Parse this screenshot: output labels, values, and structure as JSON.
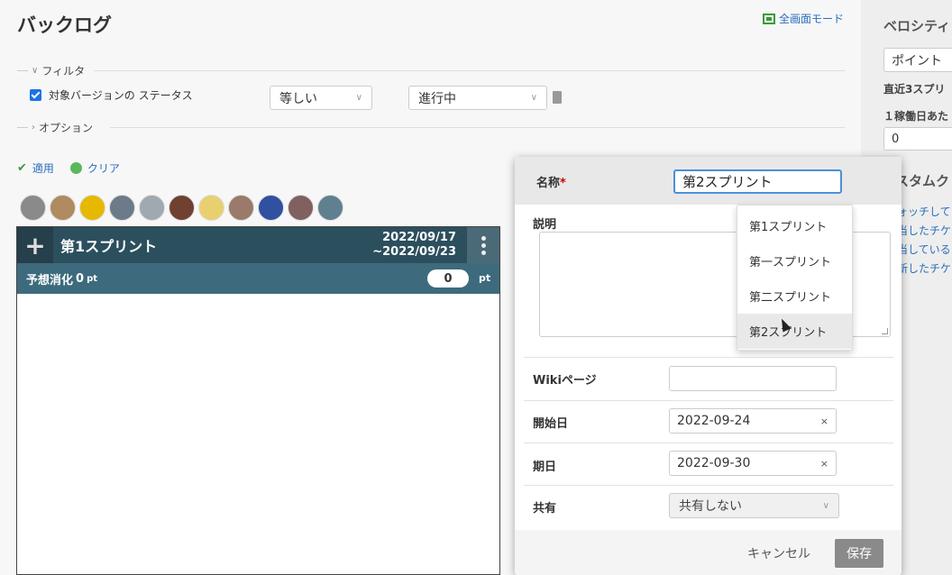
{
  "header": {
    "title": "バックログ",
    "fullscreen_label": "全画面モード"
  },
  "filter": {
    "legend": "フィルタ",
    "checkbox_label": "対象バージョンの ステータス",
    "checked": true,
    "operator": "等しい",
    "value": "進行中"
  },
  "options": {
    "legend": "オプション"
  },
  "actions": {
    "apply": "適用",
    "clear": "クリア"
  },
  "avatar_colors": [
    "#8a8a8a",
    "#b08a60",
    "#e6b800",
    "#6c7a89",
    "#a0a8b0",
    "#704030",
    "#e8d070",
    "#9a7a6a",
    "#3050a0",
    "#806060",
    "#608090"
  ],
  "sprint": {
    "title": "第1スプリント",
    "date_start": "2022/09/17",
    "date_end": "~2022/09/23",
    "forecast_label": "予想消化",
    "forecast_value": "0",
    "forecast_unit": "pt",
    "points_value": "0",
    "points_unit": "pt"
  },
  "sidebar": {
    "title": "ベロシティ",
    "select_value": "ポイント",
    "recent_label": "直近3スプリ",
    "per_day_label": "１稼働日あた",
    "per_day_value": "0",
    "custom_heading": "スタムク",
    "links": [
      "ォッチして",
      "当したチケ",
      "当している",
      "新したチケ"
    ]
  },
  "modal": {
    "name_label": "名称",
    "required_mark": "*",
    "name_value": "第2スプリント",
    "description_label": "説明",
    "wiki_label": "Wikiページ",
    "wiki_value": "",
    "start_label": "開始日",
    "start_value": "2022-09-24",
    "due_label": "期日",
    "due_value": "2022-09-30",
    "clear_mark": "×",
    "share_label": "共有",
    "share_value": "共有しない",
    "cancel_label": "キャンセル",
    "save_label": "保存"
  },
  "autocomplete": {
    "items": [
      "第1スプリント",
      "第一スプリント",
      "第二スプリント",
      "第2スプリント"
    ],
    "active_index": 3
  }
}
